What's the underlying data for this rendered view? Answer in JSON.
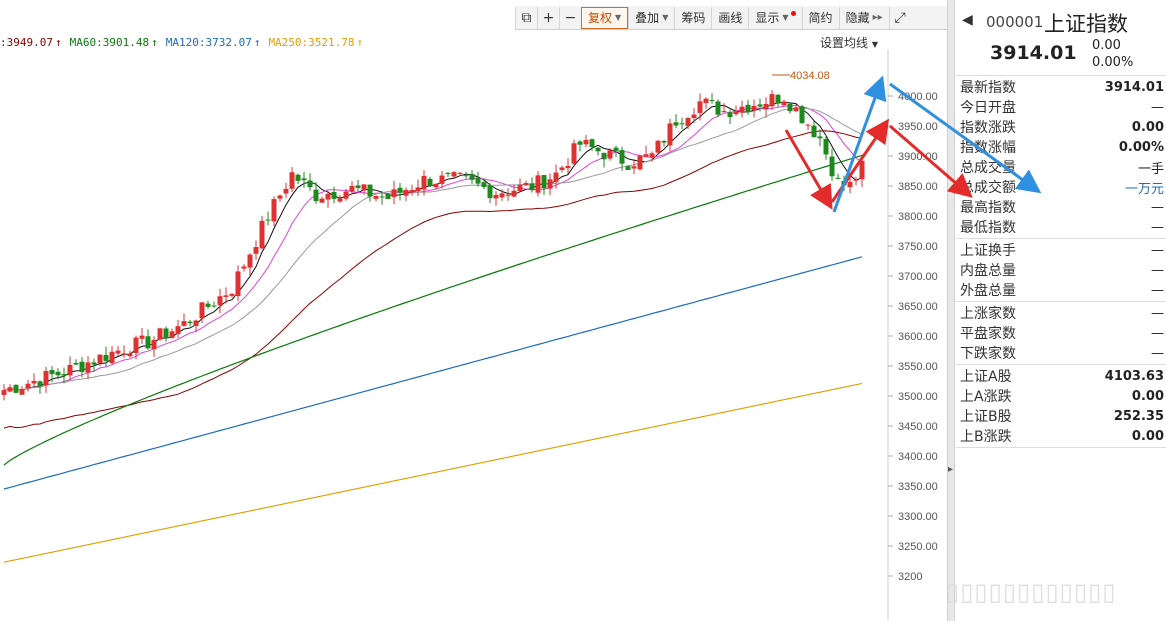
{
  "toolbar": {
    "buttons": [
      "复权",
      "叠加",
      "筹码",
      "画线",
      "显示",
      "简约",
      "隐藏"
    ]
  },
  "ma_legend": [
    {
      "label": ":3949.07",
      "color": "#8b0000"
    },
    {
      "label": "MA60:3901.48",
      "color": "#0a7a0a"
    },
    {
      "label": "MA120:3732.07",
      "color": "#1a6cc2"
    },
    {
      "label": "MA250:3521.78",
      "color": "#e0a000"
    }
  ],
  "ma_settings_label": "设置均线",
  "high_annotation": "4034.08",
  "y_ticks": [
    "4000.00",
    "3950.00",
    "3900.00",
    "3850.00",
    "3800.00",
    "3750.00",
    "3700.00",
    "3650.00",
    "3600.00",
    "3550.00",
    "3500.00",
    "3450.00",
    "3400.00",
    "3350.00",
    "3300.00",
    "3250.00",
    "3200"
  ],
  "panel": {
    "code": "000001",
    "name": "上证指数",
    "price": "3914.01",
    "change": "0.00",
    "change_pct": "0.00%",
    "groups": [
      [
        {
          "label": "最新指数",
          "value": "3914.01",
          "style": "bold"
        },
        {
          "label": "今日开盘",
          "value": "—",
          "style": "green"
        },
        {
          "label": "指数涨跌",
          "value": "0.00",
          "style": "bold"
        },
        {
          "label": "指数涨幅",
          "value": "0.00%",
          "style": "bold"
        },
        {
          "label": "总成交量",
          "value": "一手",
          "style": "plain"
        },
        {
          "label": "总成交额",
          "value": "一万元",
          "style": "blue"
        },
        {
          "label": "最高指数",
          "value": "—",
          "style": "green"
        },
        {
          "label": "最低指数",
          "value": "—",
          "style": "green"
        }
      ],
      [
        {
          "label": "上证换手",
          "value": "—",
          "style": "gray"
        },
        {
          "label": "内盘总量",
          "value": "—",
          "style": "green"
        },
        {
          "label": "外盘总量",
          "value": "—",
          "style": "red"
        }
      ],
      [
        {
          "label": "上涨家数",
          "value": "—",
          "style": "red"
        },
        {
          "label": "平盘家数",
          "value": "—",
          "style": "gray"
        },
        {
          "label": "下跌家数",
          "value": "—",
          "style": "green"
        }
      ],
      [
        {
          "label": "上证A股",
          "value": "4103.63",
          "style": "bold"
        },
        {
          "label": "上A涨跌",
          "value": "0.00",
          "style": "bold"
        },
        {
          "label": "上证B股",
          "value": "252.35",
          "style": "bold"
        },
        {
          "label": "上B涨跌",
          "value": "0.00",
          "style": "bold"
        }
      ]
    ]
  },
  "colors": {
    "up": "#e03131",
    "down": "#1e8a1e",
    "ma5": "#111111",
    "ma10": "#e040e0",
    "ma20": "#9a9a9a",
    "ma30": "#8b0000",
    "ma60": "#0a7a0a",
    "ma120": "#1a6cc2",
    "ma250": "#e0a000",
    "arrow_red": "#e32b2b",
    "arrow_blue": "#2f8fe0"
  }
}
